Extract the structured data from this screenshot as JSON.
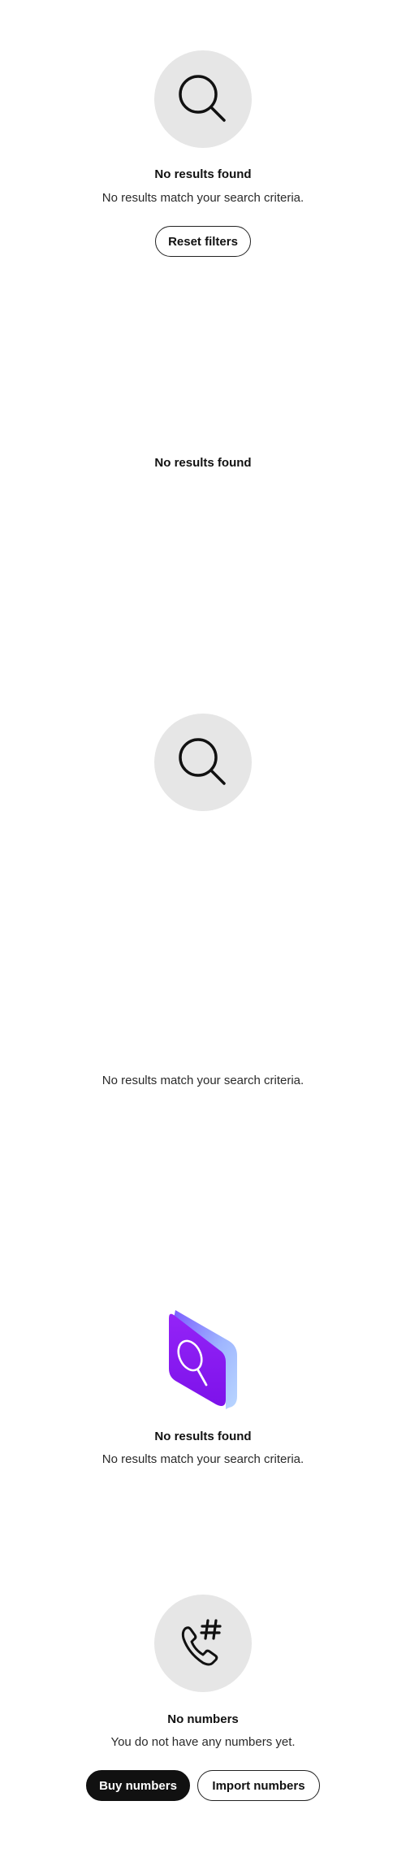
{
  "section1": {
    "icon": "search-icon",
    "title": "No results found",
    "description": "No results match your search criteria.",
    "reset_label": "Reset filters"
  },
  "section2": {
    "title": "No results found"
  },
  "section3": {
    "icon": "search-icon"
  },
  "section4": {
    "description": "No results match your search criteria."
  },
  "section5": {
    "icon": "isometric-search-icon",
    "title": "No results found",
    "description": "No results match your search criteria.",
    "colors": {
      "face": "#8a1ff2",
      "side": "#a7c8ff"
    }
  },
  "section6": {
    "icon": "phone-hash-icon",
    "title": "No numbers",
    "description": "You do not have any numbers yet.",
    "buy_label": "Buy numbers",
    "import_label": "Import numbers"
  },
  "colors": {
    "circle_bg": "#e6e6e6",
    "primary_button": "#111111"
  }
}
